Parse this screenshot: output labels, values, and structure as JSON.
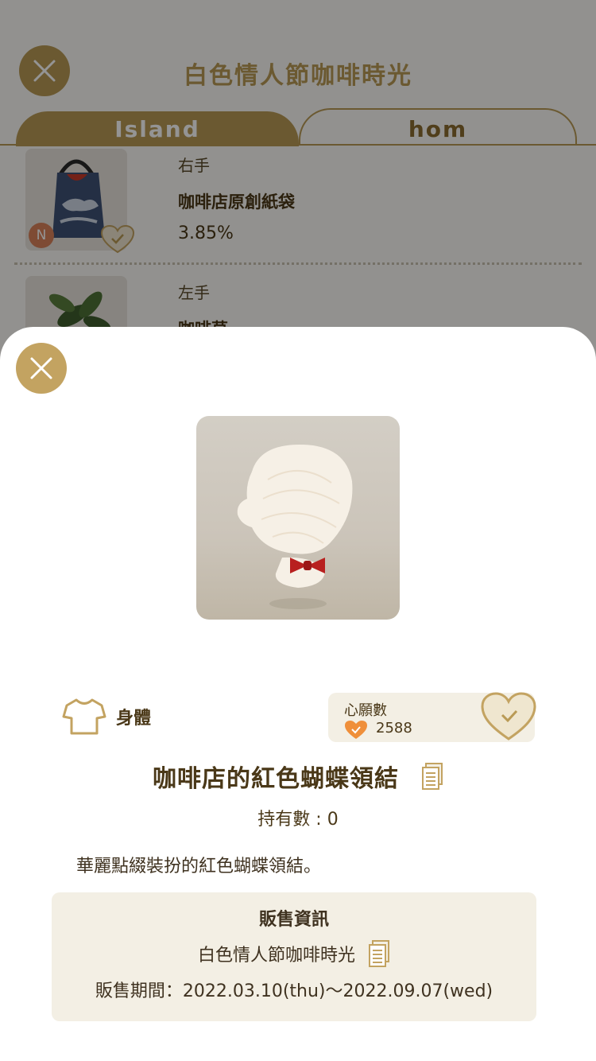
{
  "background": {
    "title": "白色情人節咖啡時光",
    "tabs": [
      {
        "label": "Island"
      },
      {
        "label": "hom"
      }
    ],
    "items": [
      {
        "slot": "右手",
        "name": "咖啡店原創紙袋",
        "rate": "3.85%",
        "badge": "N"
      },
      {
        "slot": "左手",
        "name": "咖啡草"
      }
    ]
  },
  "detail": {
    "category_icon": "shirt-icon",
    "category_label": "身體",
    "wish_label": "心願數",
    "wish_count": "2588",
    "item_name": "咖啡店的紅色蝴蝶領結",
    "owned_text": "持有數 : 0",
    "description": "華麗點綴裝扮的紅色蝴蝶領結。",
    "sale_info": {
      "heading": "販售資訊",
      "event_name": "白色情人節咖啡時光",
      "period": "販售期間：2022.03.10(thu)～2022.09.07(wed)"
    }
  },
  "colors": {
    "accent": "#c3a361",
    "text_dark": "#4a3818",
    "panel_bg": "#f3efe4",
    "heart_orange": "#ef8f3a",
    "bow_red": "#b8201f"
  }
}
